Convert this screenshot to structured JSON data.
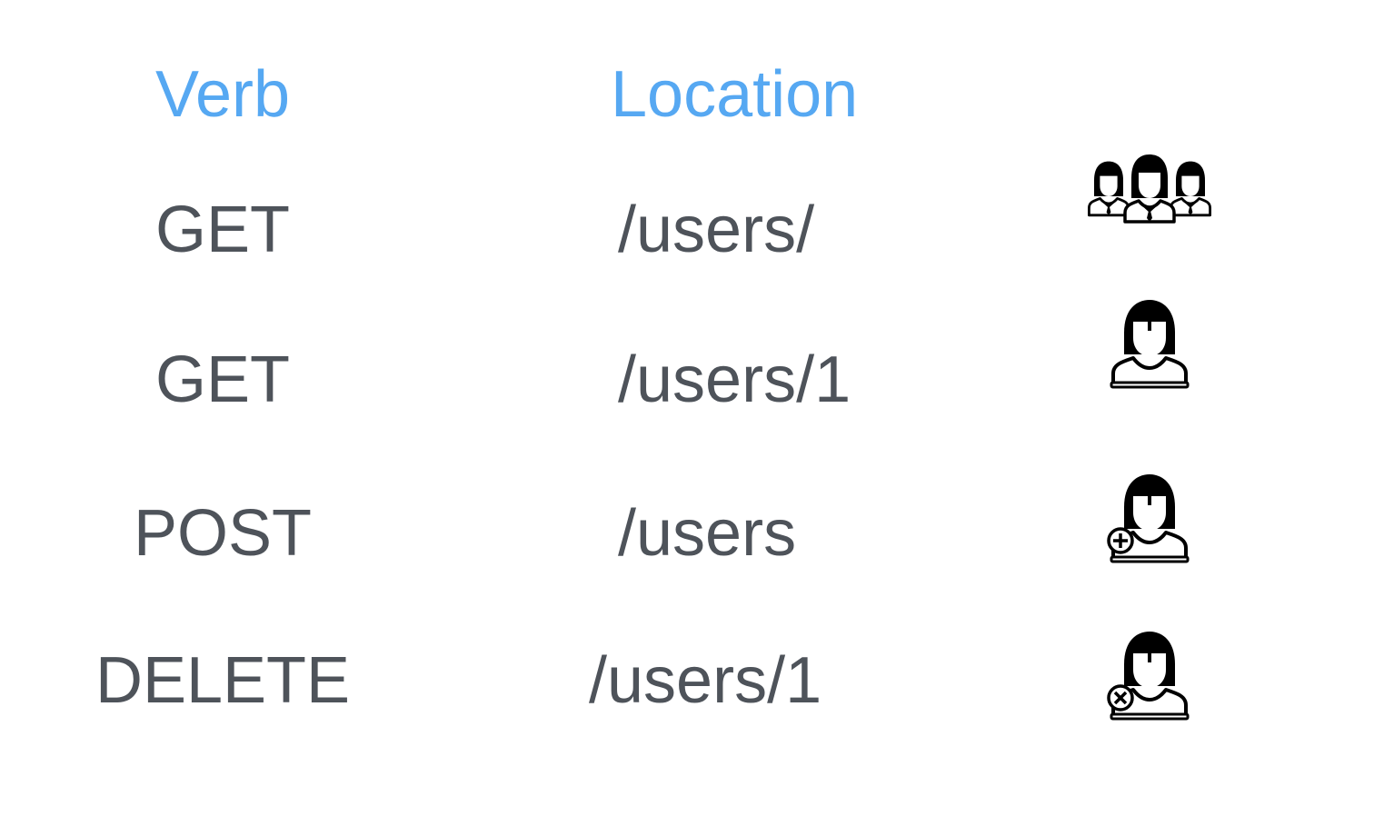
{
  "colors": {
    "header": "#56a8f2",
    "text": "#4e535a",
    "icon": "#000000",
    "background": "#ffffff"
  },
  "headers": {
    "verb": "Verb",
    "location": "Location"
  },
  "rows": [
    {
      "verb": "GET",
      "location": "/users/",
      "icon": "users-group-icon"
    },
    {
      "verb": "GET",
      "location": "/users/1",
      "icon": "user-icon"
    },
    {
      "verb": "POST",
      "location": "/users",
      "icon": "user-add-icon"
    },
    {
      "verb": "DELETE",
      "location": "/users/1",
      "icon": "user-delete-icon"
    }
  ]
}
